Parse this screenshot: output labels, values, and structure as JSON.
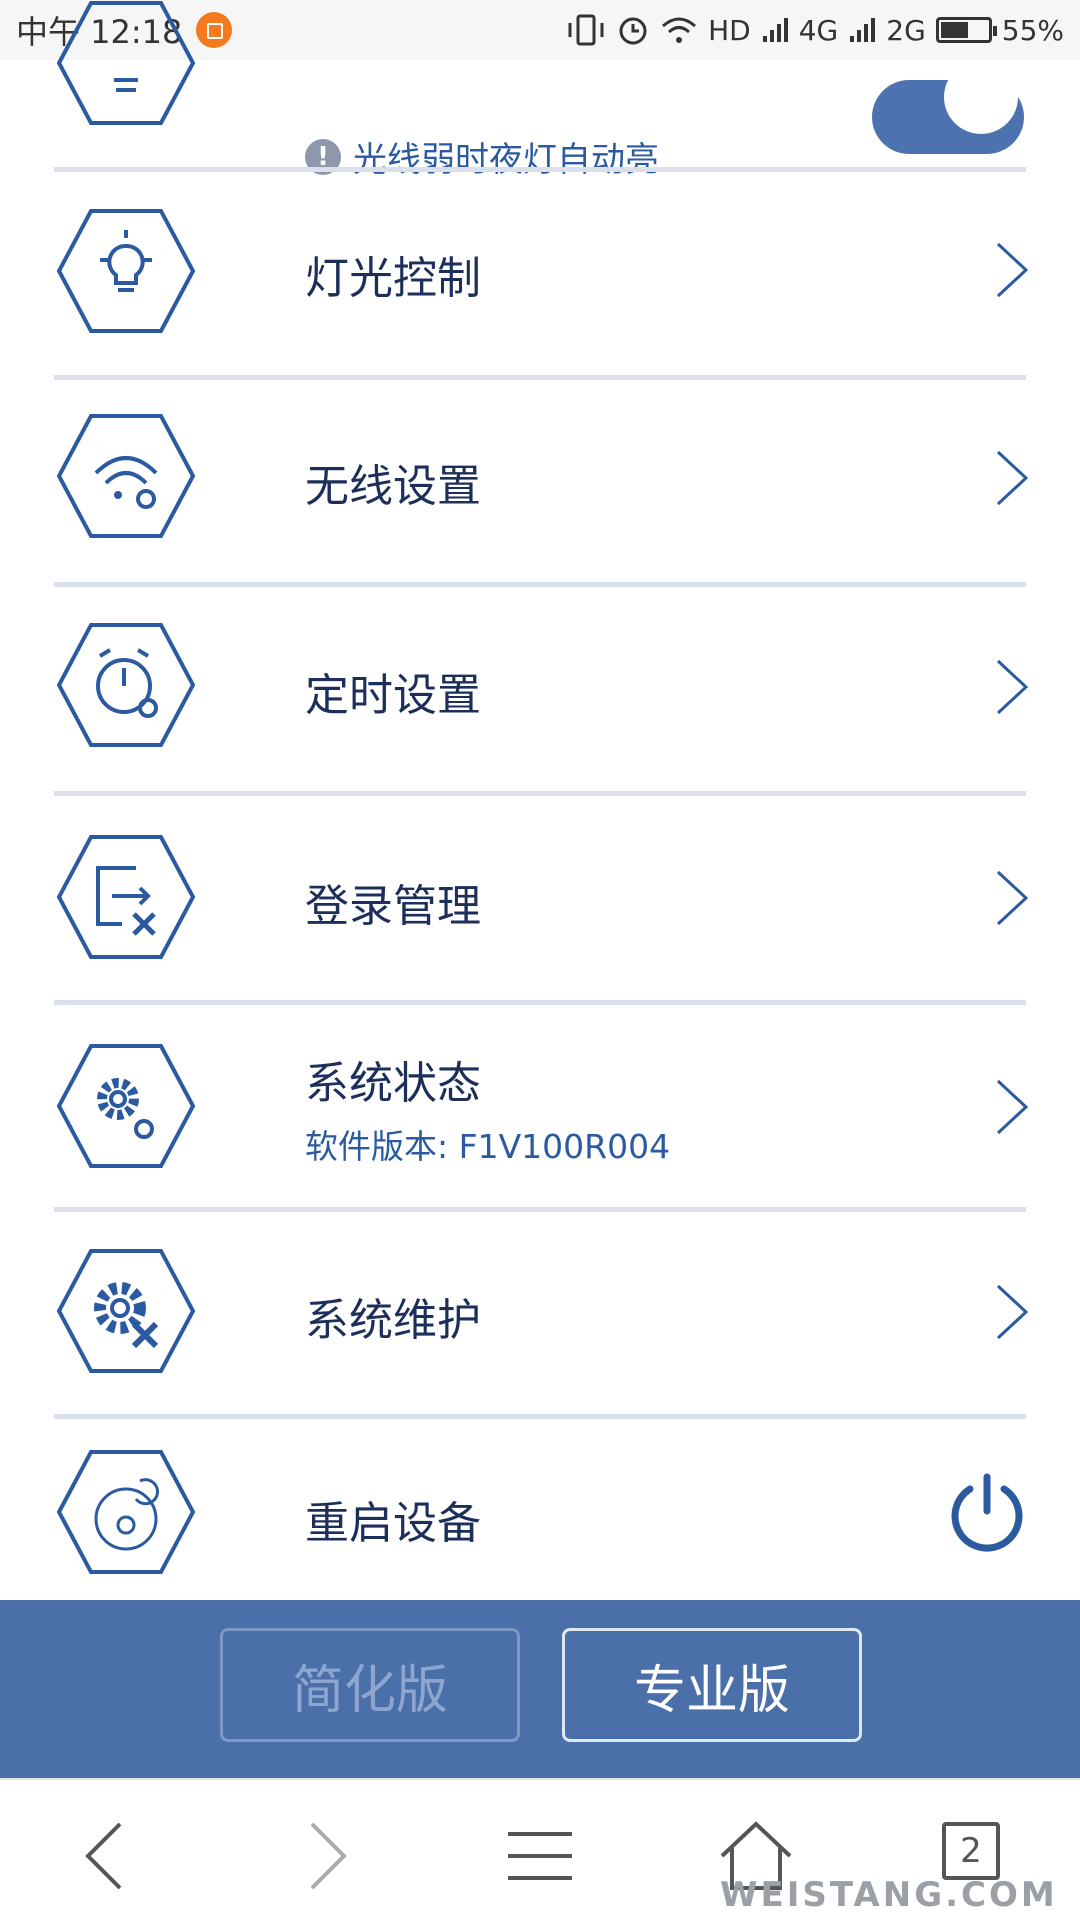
{
  "status_bar": {
    "time": "中午 12:18",
    "network": "HD",
    "sig1": "4G",
    "sig2": "2G",
    "battery": "55%"
  },
  "top_row": {
    "warning_text": "光线弱时夜灯自动亮",
    "toggle_on": true
  },
  "menu": {
    "light_control": "灯光控制",
    "wireless_settings": "无线设置",
    "timer_settings": "定时设置",
    "login_management": "登录管理",
    "system_status": "系统状态",
    "software_version": "软件版本:  F1V100R004",
    "system_maintenance": "系统维护",
    "restart_device": "重启设备"
  },
  "version_switch": {
    "simple": "简化版",
    "pro": "专业版"
  },
  "browser_nav": {
    "tab_count": "2"
  },
  "watermark": "WEISTANG.COM",
  "colors": {
    "accent": "#2b5aa0",
    "bar": "#4a6fa9",
    "divider": "#d9e0ec"
  }
}
